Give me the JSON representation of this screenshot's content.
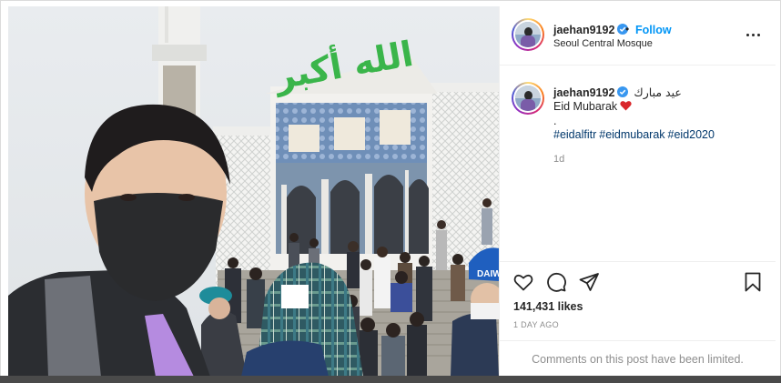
{
  "post": {
    "username": "jaehan9192",
    "follow_label": "Follow",
    "separator": "•",
    "location": "Seoul Central Mosque",
    "caption": {
      "username": "jaehan9192",
      "arabic_text": "عيد مبارك",
      "line2": "Eid Mubarak",
      "line3": ".",
      "hashtags": [
        "#eidalfitr",
        "#eidmubarak",
        "#eid2020"
      ],
      "time": "1d"
    },
    "likes": "141,431 likes",
    "timestamp": "1 DAY AGO",
    "comments_notice": "Comments on this post have been limited.",
    "photo": {
      "sign_text": "الله أكبر",
      "cap_logo": "DAIWA"
    }
  },
  "icons": {
    "verified": "verified-badge-icon",
    "more": "more-options-icon",
    "like": "heart-icon",
    "comment": "comment-icon",
    "share": "paper-plane-icon",
    "save": "bookmark-icon",
    "emoji": "red-heart-emoji"
  },
  "colors": {
    "link_blue": "#0095f6",
    "hashtag_blue": "#00376b",
    "muted": "#8e8e8e",
    "sign_green": "#3ab54a"
  }
}
